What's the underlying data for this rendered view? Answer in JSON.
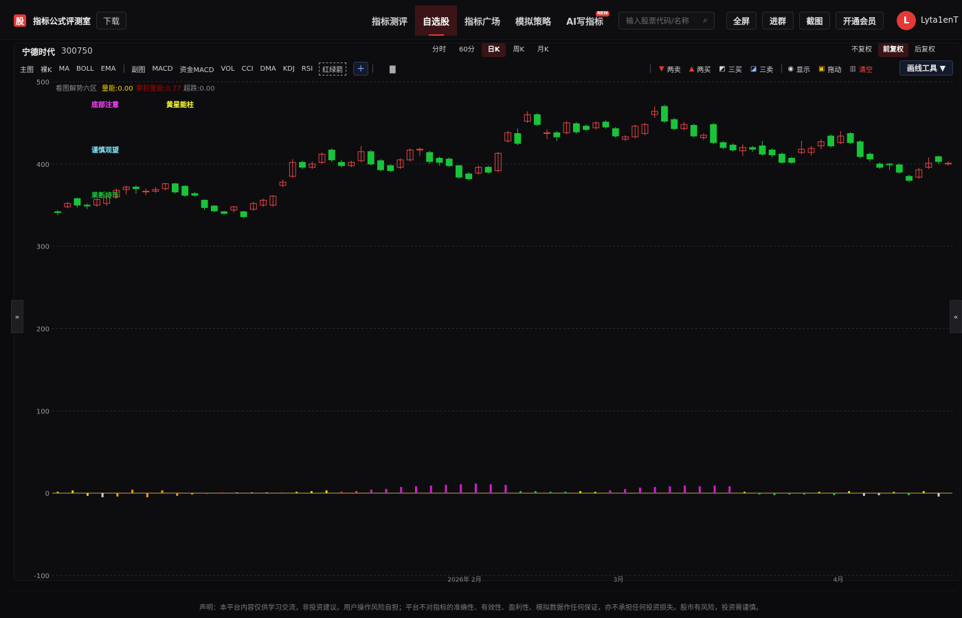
{
  "brand": {
    "badge": "股",
    "title": "指标公式评测室",
    "download": "下载"
  },
  "nav": [
    {
      "label": "指标测评",
      "active": false
    },
    {
      "label": "自选股",
      "active": true
    },
    {
      "label": "指标广场",
      "active": false
    },
    {
      "label": "模拟策略",
      "active": false
    },
    {
      "label": "AI写指标",
      "active": false,
      "badge": "NEW"
    }
  ],
  "search": {
    "placeholder": "输入股票代码/名称"
  },
  "top_buttons": {
    "fullscreen": "全屏",
    "group": "进群",
    "screenshot": "截图",
    "vip": "开通会员"
  },
  "user": {
    "initial": "L",
    "name": "Lyta1enT"
  },
  "stock": {
    "name": "宁德时代",
    "code": "300750"
  },
  "periods": [
    {
      "label": "分时",
      "active": false
    },
    {
      "label": "60分",
      "active": false
    },
    {
      "label": "日K",
      "active": true
    },
    {
      "label": "周K",
      "active": false
    },
    {
      "label": "月K",
      "active": false
    }
  ],
  "adjusts": [
    {
      "label": "不复权",
      "active": false
    },
    {
      "label": "前复权",
      "active": true
    },
    {
      "label": "后复权",
      "active": false
    }
  ],
  "main_indicators": [
    "主图",
    "裸K",
    "MA",
    "BOLL",
    "EMA"
  ],
  "sub_indicators": [
    "副图",
    "MACD",
    "资金MACD",
    "VOL",
    "CCI",
    "DMA",
    "KDJ",
    "RSI"
  ],
  "active_indicator": "红绿箭",
  "tools": {
    "two_sell": "两卖",
    "two_buy": "两买",
    "three_buy": "三买",
    "three_sell": "三卖",
    "show": "显示",
    "drag": "拖动",
    "clear": "清空",
    "draw_tools": "画线工具 ▼"
  },
  "legend": {
    "title": "看图解势六区",
    "v1": "量能:0.00",
    "v2": "累积量能:0.77",
    "v3": "超跌:0.00"
  },
  "annotations": [
    "底部注意",
    "黄星能柱",
    "谨慎观望",
    "果断持币"
  ],
  "colors": {
    "up": "#e84545",
    "down": "#19c43a",
    "accent": "#e53935",
    "bg": "#0b0b0d"
  },
  "chart_data": {
    "type": "candlestick",
    "y_ticks": [
      500,
      400,
      300,
      200,
      100,
      0,
      -100
    ],
    "ylim": [
      -100,
      500
    ],
    "x_labels": [
      "2026年 2月",
      "3月",
      "4月"
    ],
    "candles": [
      [
        342,
        341,
        344,
        338
      ],
      [
        348,
        352,
        354,
        346
      ],
      [
        358,
        350,
        359,
        347
      ],
      [
        350,
        349,
        352,
        345
      ],
      [
        350,
        357,
        358,
        348
      ],
      [
        352,
        360,
        362,
        349
      ],
      [
        360,
        368,
        370,
        358
      ],
      [
        369,
        372,
        374,
        363
      ],
      [
        372,
        370,
        374,
        364
      ],
      [
        366,
        367,
        370,
        362
      ],
      [
        367,
        369,
        372,
        365
      ],
      [
        370,
        376,
        377,
        368
      ],
      [
        376,
        366,
        377,
        364
      ],
      [
        373,
        362,
        374,
        360
      ],
      [
        364,
        362,
        366,
        360
      ],
      [
        356,
        347,
        357,
        344
      ],
      [
        349,
        343,
        350,
        341
      ],
      [
        342,
        340,
        343,
        338
      ],
      [
        344,
        348,
        349,
        341
      ],
      [
        342,
        336,
        343,
        334
      ],
      [
        345,
        352,
        354,
        343
      ],
      [
        350,
        356,
        358,
        348
      ],
      [
        350,
        361,
        362,
        348
      ],
      [
        374,
        378,
        381,
        372
      ],
      [
        385,
        402,
        406,
        383
      ],
      [
        402,
        396,
        404,
        394
      ],
      [
        396,
        400,
        403,
        394
      ],
      [
        402,
        412,
        414,
        400
      ],
      [
        417,
        405,
        419,
        402
      ],
      [
        402,
        398,
        405,
        396
      ],
      [
        398,
        402,
        404,
        396
      ],
      [
        404,
        415,
        422,
        402
      ],
      [
        415,
        400,
        417,
        398
      ],
      [
        404,
        393,
        406,
        391
      ],
      [
        398,
        392,
        400,
        390
      ],
      [
        396,
        405,
        407,
        394
      ],
      [
        405,
        417,
        419,
        403
      ],
      [
        418,
        418,
        420,
        410
      ],
      [
        414,
        403,
        416,
        400
      ],
      [
        407,
        402,
        409,
        398
      ],
      [
        406,
        398,
        408,
        396
      ],
      [
        398,
        384,
        399,
        382
      ],
      [
        388,
        382,
        390,
        380
      ],
      [
        389,
        396,
        398,
        387
      ],
      [
        396,
        390,
        398,
        388
      ],
      [
        392,
        413,
        415,
        390
      ],
      [
        428,
        438,
        440,
        426
      ],
      [
        437,
        425,
        443,
        423
      ],
      [
        452,
        460,
        464,
        450
      ],
      [
        460,
        448,
        462,
        446
      ],
      [
        438,
        438,
        442,
        430
      ],
      [
        438,
        433,
        440,
        428
      ],
      [
        438,
        450,
        452,
        436
      ],
      [
        449,
        439,
        451,
        437
      ],
      [
        446,
        442,
        448,
        440
      ],
      [
        444,
        450,
        452,
        442
      ],
      [
        451,
        445,
        453,
        443
      ],
      [
        443,
        434,
        445,
        432
      ],
      [
        430,
        433,
        435,
        428
      ],
      [
        433,
        446,
        448,
        431
      ],
      [
        437,
        448,
        450,
        435
      ],
      [
        460,
        464,
        470,
        456
      ],
      [
        470,
        452,
        472,
        450
      ],
      [
        454,
        443,
        456,
        441
      ],
      [
        443,
        448,
        451,
        441
      ],
      [
        447,
        434,
        449,
        432
      ],
      [
        432,
        435,
        437,
        429
      ],
      [
        448,
        426,
        450,
        424
      ],
      [
        426,
        420,
        428,
        418
      ],
      [
        423,
        417,
        425,
        415
      ],
      [
        416,
        420,
        424,
        410
      ],
      [
        420,
        418,
        422,
        415
      ],
      [
        422,
        412,
        428,
        410
      ],
      [
        417,
        411,
        419,
        408
      ],
      [
        412,
        402,
        414,
        400
      ],
      [
        407,
        402,
        409,
        400
      ],
      [
        414,
        418,
        428,
        412
      ],
      [
        414,
        419,
        422,
        410
      ],
      [
        422,
        427,
        430,
        418
      ],
      [
        434,
        422,
        436,
        420
      ],
      [
        426,
        434,
        440,
        424
      ],
      [
        437,
        426,
        439,
        424
      ],
      [
        427,
        409,
        429,
        407
      ],
      [
        412,
        406,
        414,
        403
      ],
      [
        400,
        396,
        402,
        394
      ],
      [
        400,
        399,
        401,
        393
      ],
      [
        399,
        390,
        401,
        388
      ],
      [
        385,
        380,
        387,
        378
      ],
      [
        384,
        393,
        395,
        382
      ],
      [
        396,
        401,
        408,
        394
      ],
      [
        409,
        403,
        410,
        400
      ],
      [
        401,
        401,
        403,
        398
      ]
    ],
    "sub_bars": [
      [
        2,
        "#f0d000"
      ],
      [
        4,
        "#f0d000"
      ],
      [
        -4,
        "#f0d000"
      ],
      [
        -6,
        "#cfcfcf"
      ],
      [
        -5,
        "#f59a00"
      ],
      [
        5,
        "#f59a00"
      ],
      [
        -6,
        "#f59a00"
      ],
      [
        4,
        "#f59a00"
      ],
      [
        -4,
        "#f59a00"
      ],
      [
        -2,
        "#f59a00"
      ],
      [
        -1,
        "#e84545"
      ],
      [
        1,
        "#e84545"
      ],
      [
        1,
        "#cfcfcf"
      ],
      [
        1,
        "#cfcfcf"
      ],
      [
        1,
        "#cfcfcf"
      ],
      [
        1,
        "#e84545"
      ],
      [
        2,
        "#f0d000"
      ],
      [
        3,
        "#f0d000"
      ],
      [
        4,
        "#f0d000"
      ],
      [
        2,
        "#e84545"
      ],
      [
        3,
        "#e84545"
      ],
      [
        5,
        "#cc22cc"
      ],
      [
        6,
        "#cc22cc"
      ],
      [
        9,
        "#cc22cc"
      ],
      [
        10,
        "#cc22cc"
      ],
      [
        11,
        "#cc22cc"
      ],
      [
        12,
        "#cc22cc"
      ],
      [
        13,
        "#cc22cc"
      ],
      [
        14,
        "#cc22cc"
      ],
      [
        13,
        "#cc22cc"
      ],
      [
        12,
        "#cc22cc"
      ],
      [
        3,
        "#19c43a"
      ],
      [
        3,
        "#19c43a"
      ],
      [
        2,
        "#19c43a"
      ],
      [
        2,
        "#19c43a"
      ],
      [
        3,
        "#f0d000"
      ],
      [
        2,
        "#f0d000"
      ],
      [
        4,
        "#cc22cc"
      ],
      [
        6,
        "#cc22cc"
      ],
      [
        8,
        "#cc22cc"
      ],
      [
        9,
        "#cc22cc"
      ],
      [
        10,
        "#cc22cc"
      ],
      [
        11,
        "#cc22cc"
      ],
      [
        10,
        "#cc22cc"
      ],
      [
        11,
        "#cc22cc"
      ],
      [
        10,
        "#cc22cc"
      ],
      [
        2,
        "#f0d000"
      ],
      [
        -2,
        "#19c43a"
      ],
      [
        -3,
        "#19c43a"
      ],
      [
        -2,
        "#19c43a"
      ],
      [
        -2,
        "#19c43a"
      ],
      [
        2,
        "#f0d000"
      ],
      [
        -3,
        "#19c43a"
      ],
      [
        3,
        "#f0d000"
      ],
      [
        -4,
        "#cfcfcf"
      ],
      [
        -3,
        "#cfcfcf"
      ],
      [
        2,
        "#f0d000"
      ],
      [
        -3,
        "#19c43a"
      ],
      [
        3,
        "#f0d000"
      ],
      [
        -5,
        "#cfcfcf"
      ]
    ]
  },
  "footer": {
    "disclaimer": "声明：本平台内容仅供学习交流，非投资建议。用户操作风险自担；平台不对指标的准确性、有效性、盈利性、模拟数据作任何保证，亦不承担任何投资损失。股市有风险，投资需谨慎。"
  }
}
